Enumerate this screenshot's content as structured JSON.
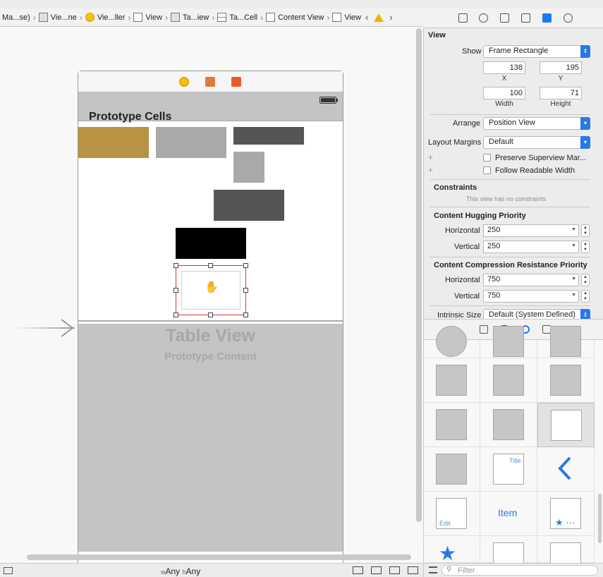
{
  "breadcrumb": {
    "items": [
      "Ma...se)",
      "Vie...ne",
      "Vie...ller",
      "View",
      "Ta...iew",
      "Ta...Cell",
      "Content View",
      "View"
    ]
  },
  "canvas": {
    "prototype_title": "Prototype Cells",
    "table_view_title": "Table View",
    "table_view_subtitle": "Prototype Content",
    "cells": [
      {
        "color": "#b89344"
      },
      {
        "color": "#a9a9a9"
      },
      {
        "color": "#555555"
      },
      {
        "color": "#a9a9a9"
      },
      {
        "color": "#555555"
      },
      {
        "color": "#000000"
      },
      {
        "color": "#ffffff"
      }
    ]
  },
  "size_class": {
    "w_prefix": "w",
    "w_value": "Any",
    "h_prefix": "h",
    "h_value": "Any"
  },
  "inspector": {
    "section_title": "View",
    "show_label": "Show",
    "show_value": "Frame Rectangle",
    "x_value": "138",
    "x_label": "X",
    "y_value": "195",
    "y_label": "Y",
    "width_value": "100",
    "width_label": "Width",
    "height_value": "71",
    "height_label": "Height",
    "arrange_label": "Arrange",
    "arrange_value": "Position View",
    "margins_label": "Layout Margins",
    "margins_value": "Default",
    "preserve_label": "Preserve Superview Mar...",
    "follow_label": "Follow Readable Width",
    "constraints_title": "Constraints",
    "constraints_empty": "This view has no constraints",
    "hugging_title": "Content Hugging Priority",
    "hugging_h_label": "Horizontal",
    "hugging_h_value": "250",
    "hugging_v_label": "Vertical",
    "hugging_v_value": "250",
    "compression_title": "Content Compression Resistance Priority",
    "compression_h_label": "Horizontal",
    "compression_h_value": "750",
    "compression_v_label": "Vertical",
    "compression_v_value": "750",
    "intrinsic_label": "Intrinsic Size",
    "intrinsic_value": "Default (System Defined)"
  },
  "library": {
    "back_title": "Title",
    "item_label": "Item",
    "edit_label": "Edit",
    "filter_placeholder": "Filter"
  }
}
